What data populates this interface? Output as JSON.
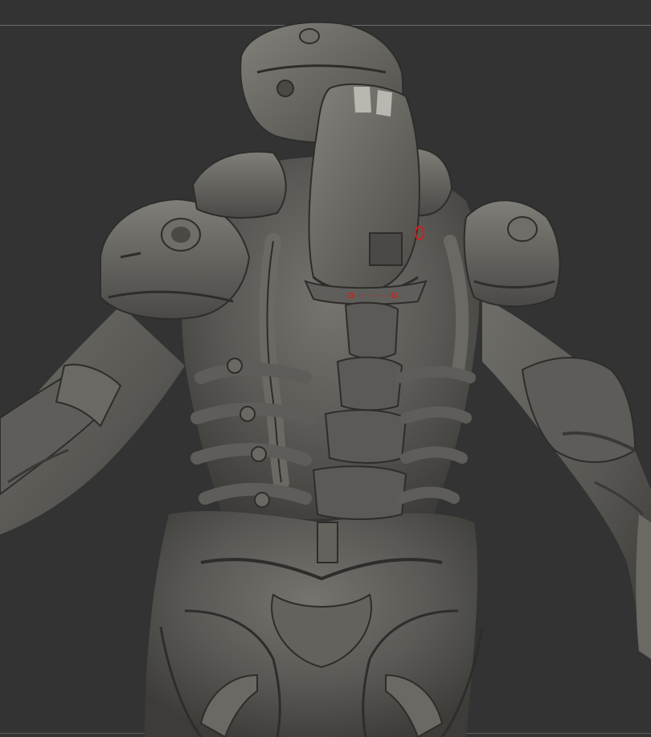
{
  "app": {
    "title": ""
  },
  "viewport": {
    "background_color": "#333333",
    "frame_line_color": "#6a6a6a",
    "model_base_color": "#5a5955",
    "model_highlight_color": "#8a8983",
    "model_shadow_color": "#2b2a28",
    "selection_marker_color": "#d0201c"
  }
}
